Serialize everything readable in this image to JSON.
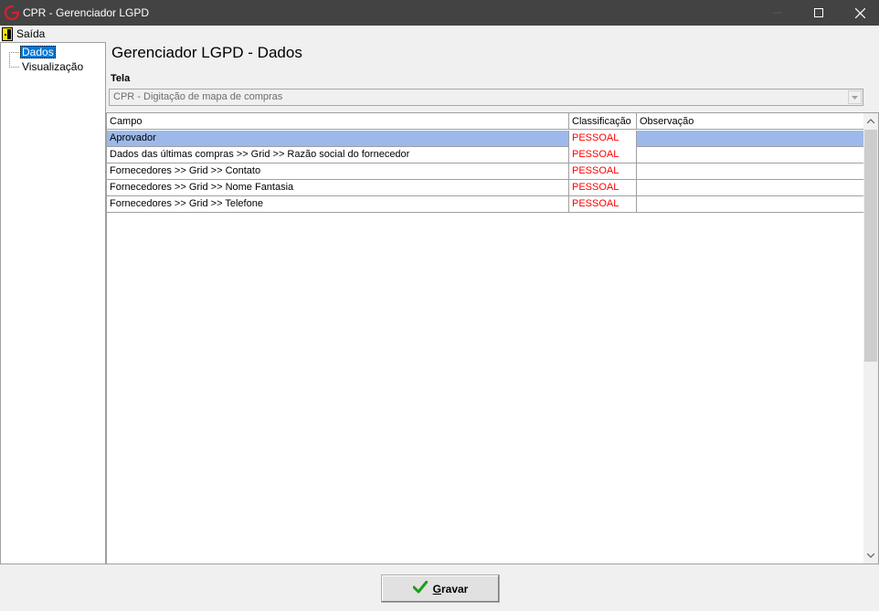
{
  "window": {
    "title": "CPR - Gerenciador LGPD"
  },
  "menu": {
    "exit_label": "Saída"
  },
  "tree": {
    "items": [
      {
        "label": "Dados",
        "selected": true
      },
      {
        "label": "Visualização",
        "selected": false
      }
    ]
  },
  "main": {
    "heading": "Gerenciador LGPD - Dados",
    "tela_label": "Tela",
    "tela_value": "CPR - Digitação de mapa de compras"
  },
  "grid": {
    "columns": [
      "Campo",
      "Classificação",
      "Observação"
    ],
    "rows": [
      {
        "campo": "Aprovador",
        "classificacao": "PESSOAL",
        "observacao": "",
        "selected": true
      },
      {
        "campo": "Dados das últimas compras >> Grid >> Razão social do fornecedor",
        "classificacao": "PESSOAL",
        "observacao": ""
      },
      {
        "campo": "Fornecedores >> Grid >> Contato",
        "classificacao": "PESSOAL",
        "observacao": ""
      },
      {
        "campo": "Fornecedores >> Grid >> Nome Fantasia",
        "classificacao": "PESSOAL",
        "observacao": ""
      },
      {
        "campo": "Fornecedores >> Grid >> Telefone",
        "classificacao": "PESSOAL",
        "observacao": ""
      }
    ]
  },
  "footer": {
    "save_label_accel": "G",
    "save_label_rest": "ravar"
  },
  "colors": {
    "titlebar": "#434343",
    "selection": "#0078d7",
    "row_highlight": "#9db9eb",
    "classification_text": "#ff0000",
    "save_check": "#1a9e1a"
  },
  "icons": {
    "app": "app-logo-icon",
    "exit": "exit-door-icon",
    "save": "checkmark-icon"
  }
}
